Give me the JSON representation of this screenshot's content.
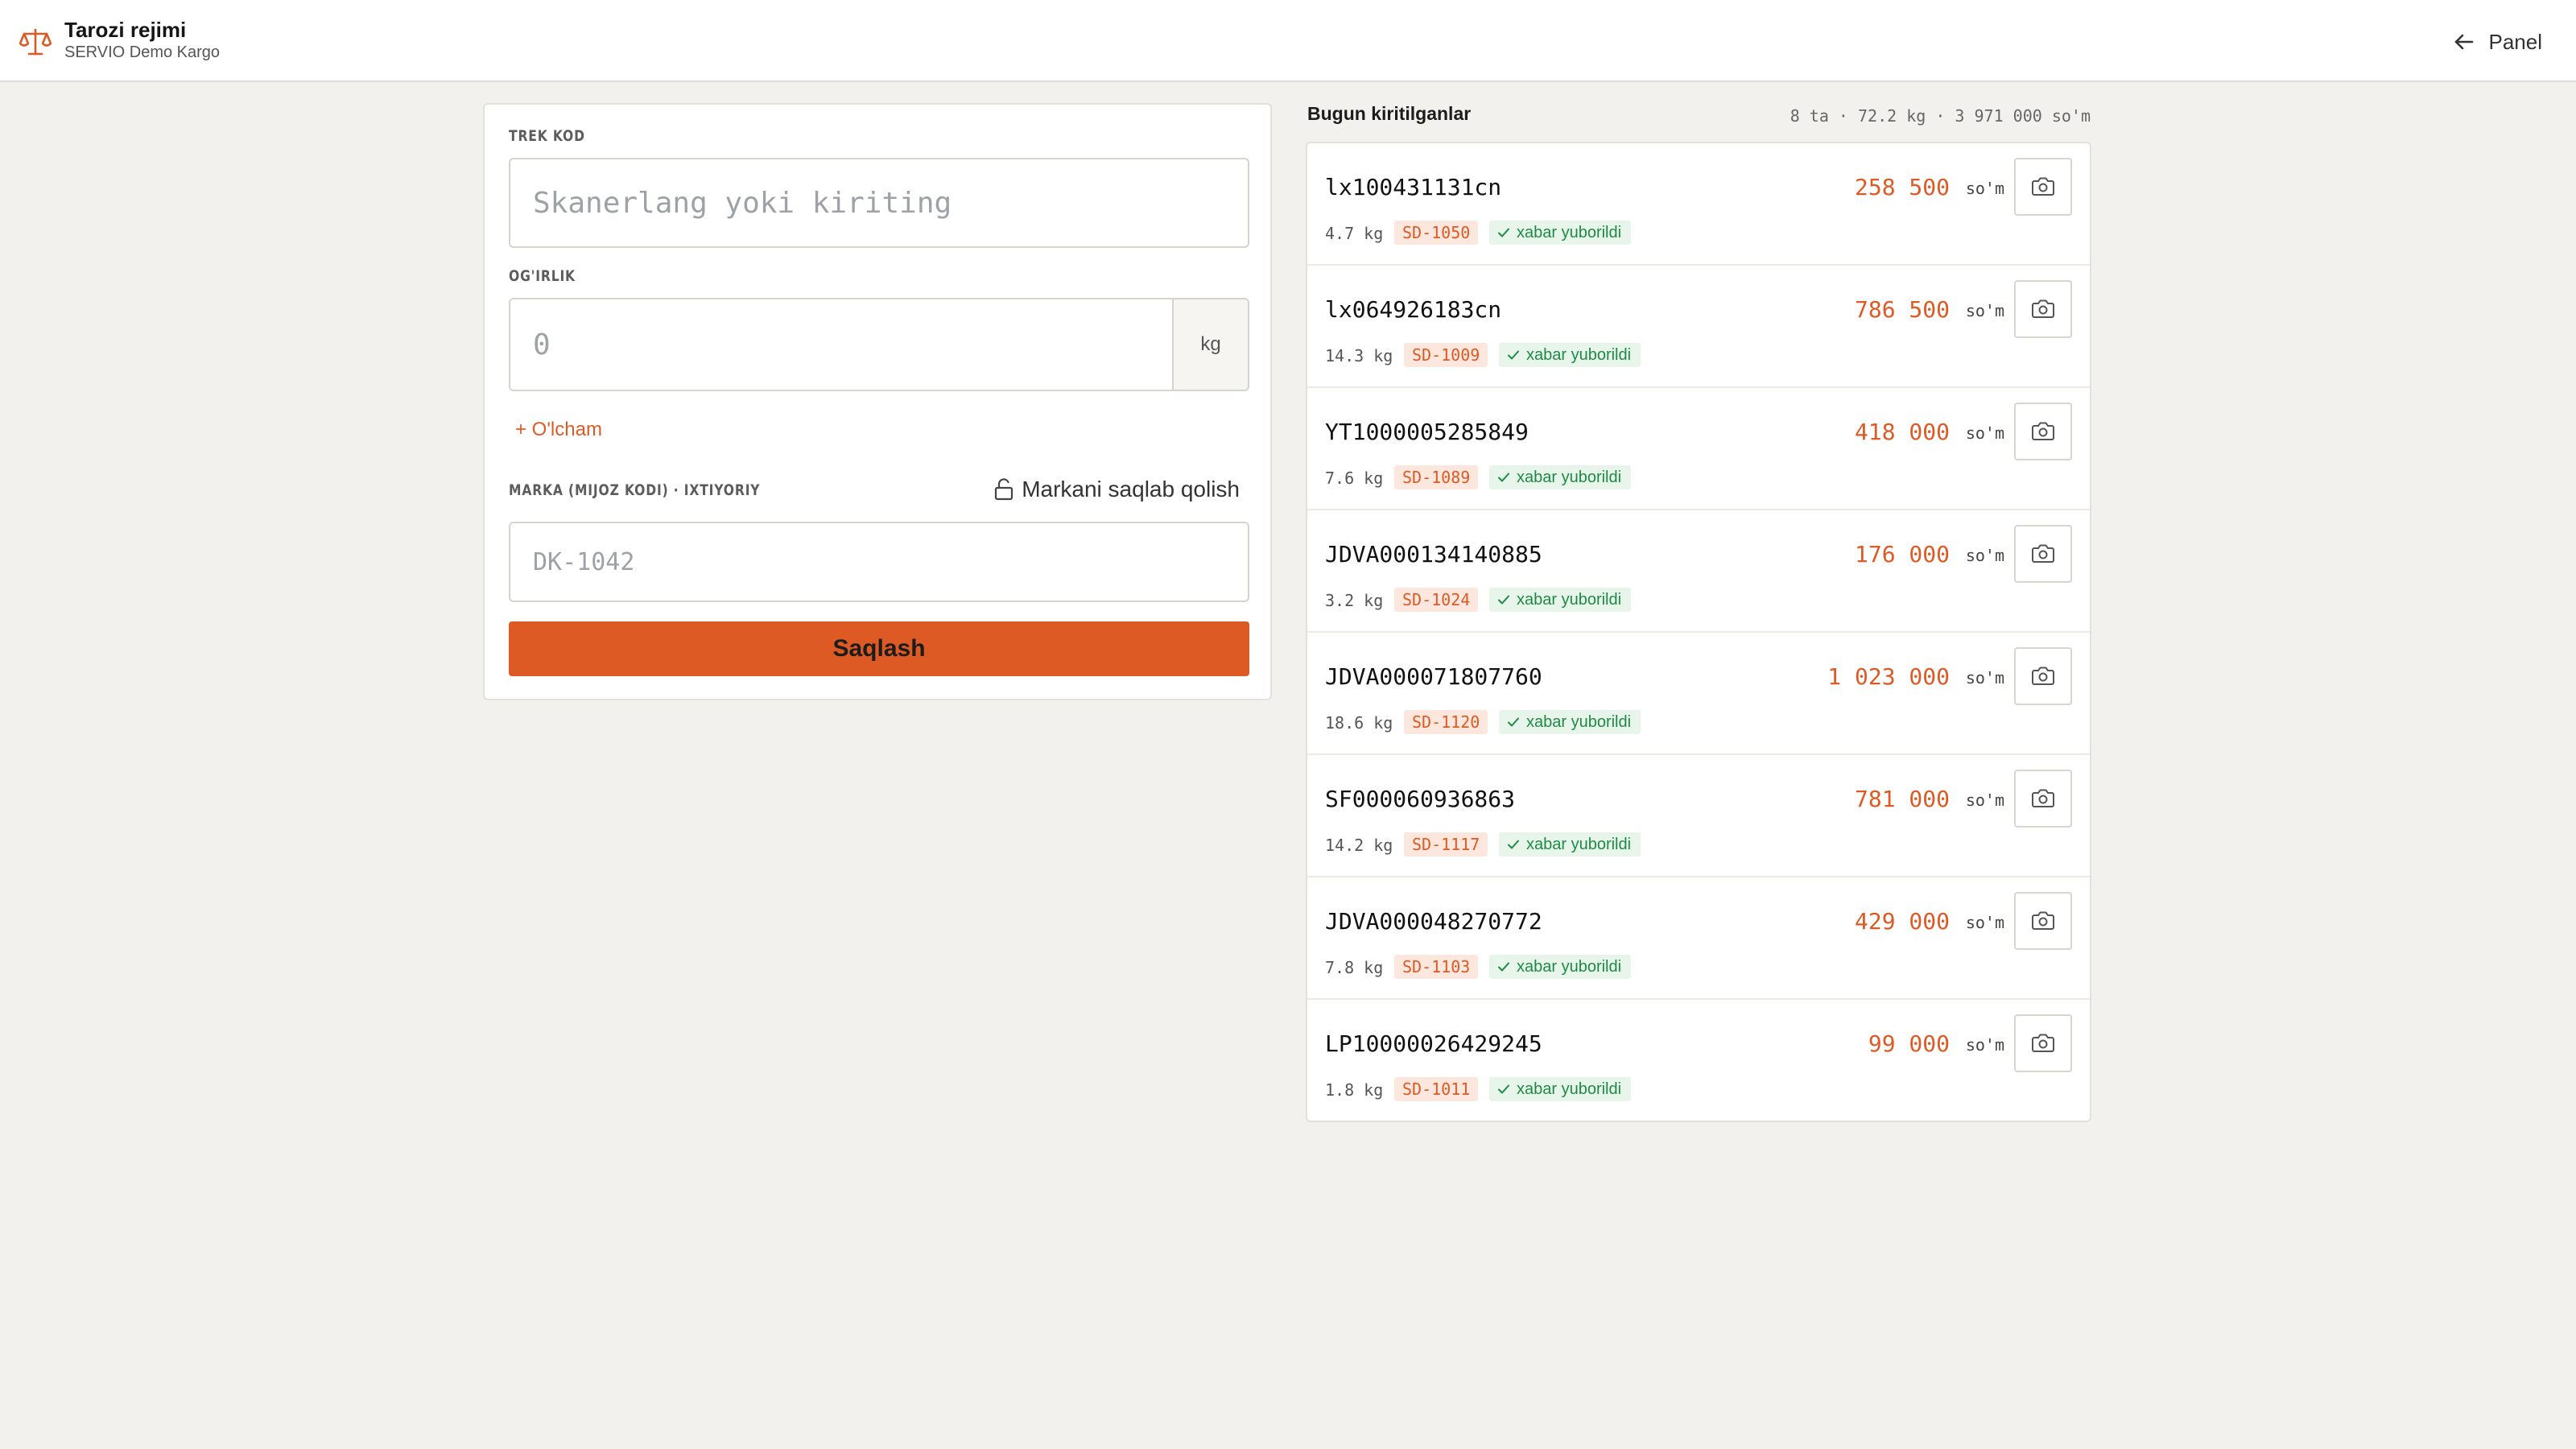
{
  "header": {
    "title": "Tarozi rejimi",
    "subtitle": "SERVIO Demo Kargo",
    "logo_icon": "scale-icon",
    "panel_label": "Panel",
    "accent": "#de5a24"
  },
  "form": {
    "trek_label": "TREK KOD",
    "trek_placeholder": "Skanerlang yoki kiriting",
    "weight_label": "OG'IRLIK",
    "weight_placeholder": "0",
    "weight_unit": "kg",
    "olcham_label": "+ O'lcham",
    "marka_label": "MARKA (MIJOZ KODI) · IXTIYORIY",
    "lock_label": "Markani saqlab qolish",
    "marka_placeholder": "DK-1042",
    "save_label": "Saqlash"
  },
  "list": {
    "title": "Bugun kiritilganlar",
    "summary": "8 ta · 72.2 kg · 3 971 000 so'm",
    "currency": "so'm",
    "status_label": "xabar yuborildi",
    "items": [
      {
        "code": "lx100431131cn",
        "kg": "4.7 kg",
        "sd": "SD-1050",
        "price": "258 500"
      },
      {
        "code": "lx064926183cn",
        "kg": "14.3 kg",
        "sd": "SD-1009",
        "price": "786 500"
      },
      {
        "code": "YT1000005285849",
        "kg": "7.6 kg",
        "sd": "SD-1089",
        "price": "418 000"
      },
      {
        "code": "JDVA000134140885",
        "kg": "3.2 kg",
        "sd": "SD-1024",
        "price": "176 000"
      },
      {
        "code": "JDVA000071807760",
        "kg": "18.6 kg",
        "sd": "SD-1120",
        "price": "1 023 000"
      },
      {
        "code": "SF000060936863",
        "kg": "14.2 kg",
        "sd": "SD-1117",
        "price": "781 000"
      },
      {
        "code": "JDVA000048270772",
        "kg": "7.8 kg",
        "sd": "SD-1103",
        "price": "429 000"
      },
      {
        "code": "LP10000026429245",
        "kg": "1.8 kg",
        "sd": "SD-1011",
        "price": "99 000"
      }
    ]
  }
}
